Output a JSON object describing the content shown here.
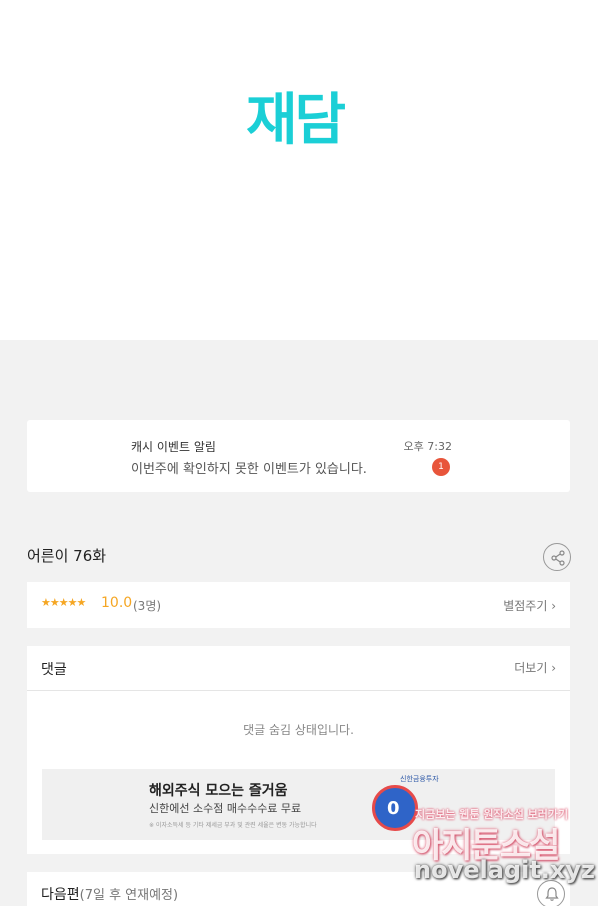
{
  "logo": {
    "text": "재담",
    "color": "#1bcfd6"
  },
  "notification": {
    "title": "캐시 이벤트 알림",
    "time": "오후 7:32",
    "message": "이번주에 확인하지 못한 이벤트가 있습니다.",
    "badge_count": "1"
  },
  "episode": {
    "title": "어른이 76화",
    "share_icon": "share-icon"
  },
  "rating": {
    "stars": "★★★★★",
    "score": "10.0",
    "count": "(3명)",
    "rate_link": "별점주기 ›"
  },
  "comments": {
    "header": "댓글",
    "more_link": "더보기 ›",
    "hidden_message": "댓글 숨김 상태입니다."
  },
  "ad": {
    "title": "해외주식 모으는 즐거움",
    "subtitle": "신한에선 소수점 매수수수료 무료",
    "fine_print": "※ 이자소득세 등 기타 제세금 부과 및 관련 세율은 변동 가능합니다",
    "badge_label": "신한금융투자",
    "circle_text": "0"
  },
  "next_episode": {
    "label": "다음편",
    "sub": "(7일 후 연재예정)"
  },
  "watermark": {
    "line1": "지금보는 웹툰 원작소설 보러가기",
    "line2": "아지툰소설",
    "line3": "novelagit.xyz"
  }
}
